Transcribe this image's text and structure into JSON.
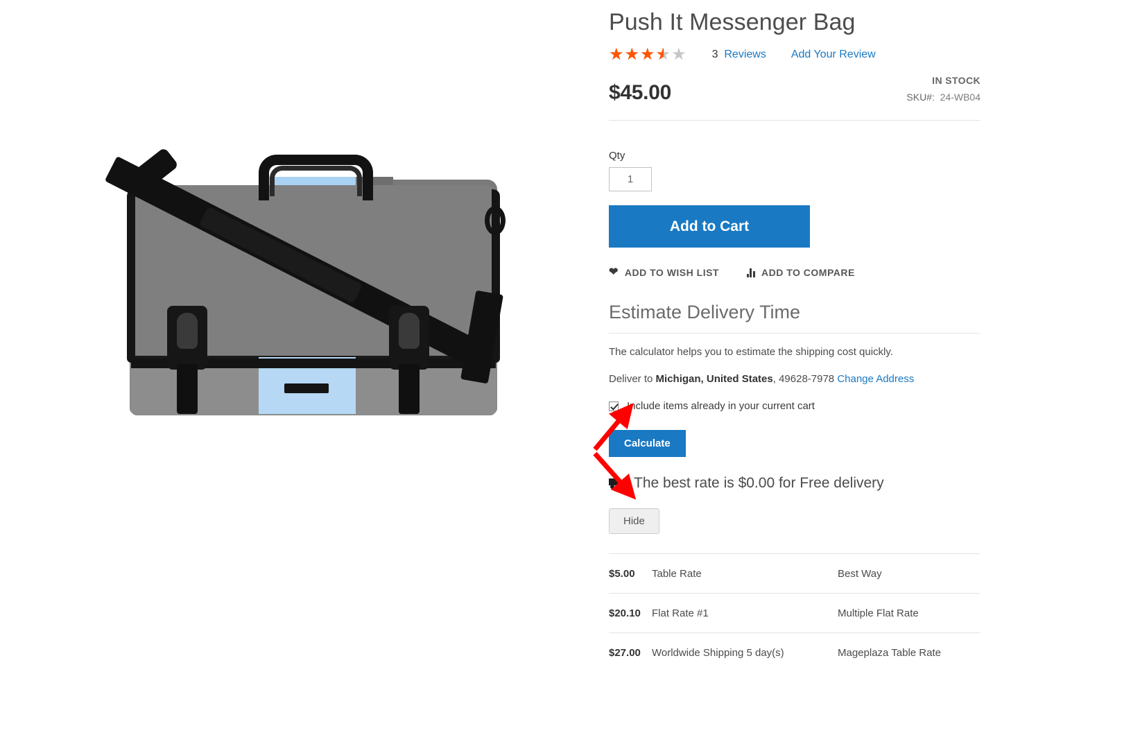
{
  "product": {
    "title": "Push It Messenger Bag",
    "rating_percent": 70,
    "rating_stars": "★★★★★",
    "reviews_count": "3",
    "reviews_label": "Reviews",
    "add_review_label": "Add Your Review",
    "price": "$45.00",
    "stock_status": "IN STOCK",
    "sku_label": "SKU#:",
    "sku_value": "24-WB04",
    "image_alt": "Push It Messenger Bag grey and light blue messenger bag with black shoulder strap",
    "colors": {
      "accent_blue": "#1979c3",
      "star_orange": "#ff5501",
      "bag_grey": "#8a8a8a",
      "bag_blue": "#a9d2f2",
      "bag_black": "#141414",
      "annotation_red": "#ff0000"
    }
  },
  "purchase": {
    "qty_label": "Qty",
    "qty_value": "1",
    "add_to_cart_label": "Add to Cart",
    "wish_list_label": "ADD TO WISH LIST",
    "compare_label": "ADD TO COMPARE"
  },
  "estimate": {
    "heading": "Estimate Delivery Time",
    "help_text": "The calculator helps you to estimate the shipping cost quickly.",
    "deliver_prefix": "Deliver to ",
    "deliver_address": "Michigan, United States",
    "deliver_zip": ", 49628-7978 ",
    "change_address_label": "Change Address",
    "include_cart_label": "Include items already in your current cart",
    "include_cart_checked": true,
    "calculate_label": "Calculate",
    "best_rate_text": "The best rate is $0.00 for Free delivery",
    "hide_label": "Hide"
  },
  "rates": [
    {
      "price": "$5.00",
      "method": "Table Rate",
      "carrier": "Best Way"
    },
    {
      "price": "$20.10",
      "method": "Flat Rate #1",
      "carrier": "Multiple Flat Rate"
    },
    {
      "price": "$27.00",
      "method": "Worldwide Shipping 5 day(s)",
      "carrier": "Mageplaza Table Rate"
    }
  ]
}
